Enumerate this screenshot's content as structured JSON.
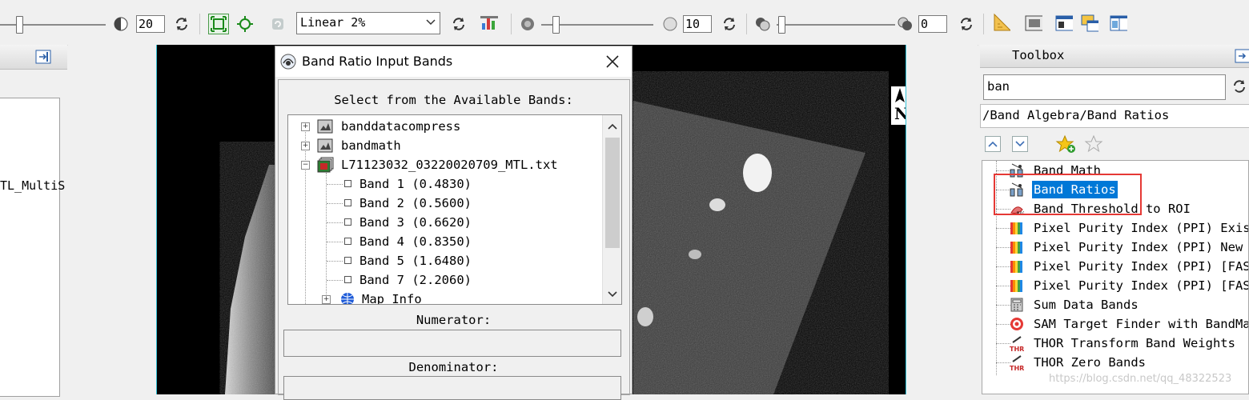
{
  "toolbar": {
    "contrast_value": "20",
    "stretch_select": "Linear 2%",
    "sharpen_value": "10",
    "transparency_value": "0"
  },
  "left_panel": {
    "item_label": "TL_MultiS"
  },
  "dialog": {
    "title": "Band Ratio Input Bands",
    "select_label": "Select from the Available Bands:",
    "tree": [
      {
        "label": "banddatacompress"
      },
      {
        "label": "bandmath"
      },
      {
        "label": "L71123032_03220020709_MTL.txt"
      }
    ],
    "bands": [
      "Band 1 (0.4830)",
      "Band 2 (0.5600)",
      "Band 3 (0.6620)",
      "Band 4 (0.8350)",
      "Band 5 (1.6480)",
      "Band 7 (2.2060)"
    ],
    "map_info": "Map Info",
    "numerator_label": "Numerator:",
    "numerator_value": "",
    "denominator_label": "Denominator:",
    "denominator_value": ""
  },
  "north_arrow": "N",
  "toolbox": {
    "title": "Toolbox",
    "search_value": "ban",
    "path": "/Band Algebra/Band Ratios",
    "items": [
      {
        "label": "Band Math",
        "icon": "band-math-icon"
      },
      {
        "label": "Band Ratios",
        "icon": "band-ratios-icon",
        "selected": true
      },
      {
        "label": "Band Threshold to ROI",
        "icon": "threshold-roi-icon"
      },
      {
        "label": "Pixel Purity Index (PPI) Exist",
        "icon": "ppi-icon"
      },
      {
        "label": "Pixel Purity Index (PPI) New O",
        "icon": "ppi-icon"
      },
      {
        "label": "Pixel Purity Index (PPI) [FAST",
        "icon": "ppi-icon"
      },
      {
        "label": "Pixel Purity Index (PPI) [FAST",
        "icon": "ppi-icon"
      },
      {
        "label": "Sum Data Bands",
        "icon": "calculator-icon"
      },
      {
        "label": "SAM Target Finder with BandMax",
        "icon": "target-icon"
      },
      {
        "label": "THOR Transform Band Weights",
        "icon": "thor-icon"
      },
      {
        "label": "THOR Zero Bands",
        "icon": "thor-icon"
      }
    ]
  },
  "watermark": "https://blog.csdn.net/qq_48322523",
  "colors": {
    "selection": "#0078d7",
    "highlight_box": "#e53935",
    "view_border": "#35c3d8"
  }
}
